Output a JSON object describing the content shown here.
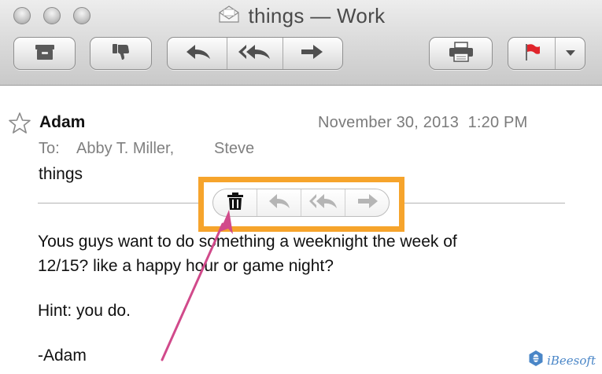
{
  "window": {
    "title": "things — Work"
  },
  "toolbar": {
    "buttons": [
      {
        "name": "archive",
        "icon": "archive-box-icon"
      },
      {
        "name": "junk",
        "icon": "thumbs-down-icon"
      },
      {
        "name": "reply",
        "icon": "reply-arrow-icon"
      },
      {
        "name": "reply-all",
        "icon": "reply-all-arrow-icon"
      },
      {
        "name": "forward",
        "icon": "forward-arrow-icon"
      },
      {
        "name": "print",
        "icon": "printer-icon"
      },
      {
        "name": "flag",
        "icon": "red-flag-icon"
      },
      {
        "name": "flag-menu",
        "icon": "chevron-down-icon"
      }
    ]
  },
  "message": {
    "from": "Adam",
    "date": "November 30, 2013  1:20 PM",
    "to_label": "To:",
    "recipients": [
      "Abby T. Miller,",
      "Steve"
    ],
    "subject": "things",
    "body": [
      "Yous guys want to do something a weeknight the week of",
      "12/15? like a happy hour or game night?",
      "Hint: you do.",
      "-Adam"
    ]
  },
  "hover_actions": [
    {
      "name": "delete",
      "icon": "trash-icon"
    },
    {
      "name": "reply",
      "icon": "reply-arrow-icon"
    },
    {
      "name": "reply-all",
      "icon": "reply-all-arrow-icon"
    },
    {
      "name": "forward",
      "icon": "forward-arrow-icon"
    }
  ],
  "colors": {
    "highlight": "#f6a42c",
    "annotation_arrow": "#d14a8b",
    "flag": "#e0242b"
  },
  "watermark": {
    "text": "iBeesoft"
  }
}
